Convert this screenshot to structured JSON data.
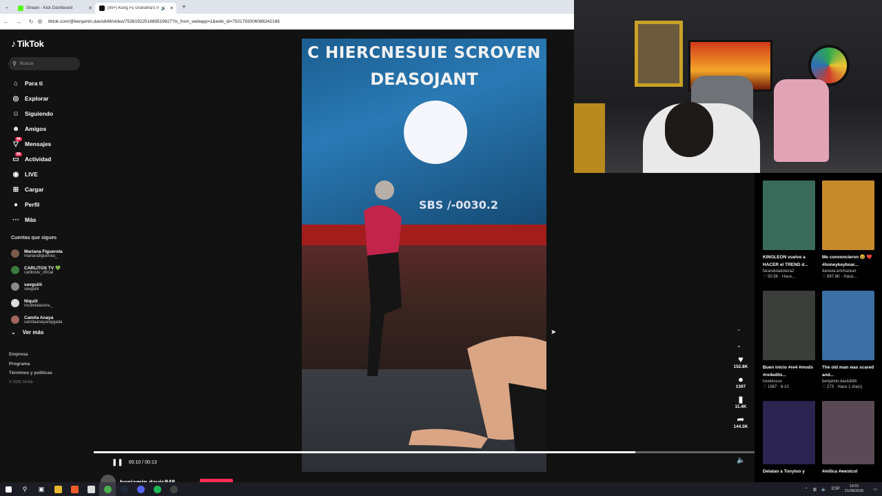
{
  "browser": {
    "tabs": [
      {
        "label": "Stream - Kick Dashboard",
        "color": "#53fc18"
      },
      {
        "label": "(99+) Kung Fu Grandma's Ir",
        "color": "#111111"
      }
    ],
    "url": "tiktok.com/@benjamin.davis848/video/7539192251889519927?is_from_webapp=1&web_id=7501793006086342166"
  },
  "tiktok": {
    "logo": "TikTok",
    "search_placeholder": "Buscar",
    "nav": [
      {
        "label": "Para ti",
        "icon": "home-icon"
      },
      {
        "label": "Explorar",
        "icon": "compass-icon"
      },
      {
        "label": "Siguiendo",
        "icon": "following-icon"
      },
      {
        "label": "Amigos",
        "icon": "friends-icon"
      },
      {
        "label": "Mensajes",
        "icon": "messages-icon",
        "badge": "44"
      },
      {
        "label": "Actividad",
        "icon": "activity-icon",
        "badge": "99"
      },
      {
        "label": "LIVE",
        "icon": "live-icon"
      },
      {
        "label": "Cargar",
        "icon": "upload-icon"
      },
      {
        "label": "Perfil",
        "icon": "profile-icon"
      },
      {
        "label": "Más",
        "icon": "more-icon"
      }
    ],
    "following_title": "Cuentas que sigues",
    "following": [
      {
        "name": "Mariana Figuerola",
        "handle": "marianafigueroia_"
      },
      {
        "name": "CARLITOS TV 💚",
        "handle": "carlitostv_oficial"
      },
      {
        "name": "savguiiii",
        "handle": "savguiiii"
      },
      {
        "name": "Niquiii",
        "handle": "nicoletalavera._"
      },
      {
        "name": "Camila Anaya",
        "handle": "camilaanayaraygada"
      }
    ],
    "see_more": "Ver más",
    "footer": [
      "Empresa",
      "Programa",
      "Términos y políticas"
    ],
    "copyright": "© 2025 TikTok"
  },
  "video": {
    "overlay_line1": "C HIERCNESUIE SCROVEN",
    "overlay_line2": "DEASOJANT",
    "overlay_code": "SBS /-0030.2",
    "time": "00:10 / 00:13",
    "progress": 0.82,
    "author": "benjamin.davis848",
    "stats": {
      "likes": "152.8K",
      "comments": "1397",
      "saves": "11.4K",
      "shares": "144.5K"
    }
  },
  "recommendations": [
    {
      "title": "KINGLEON vuelve a HACER el TREND d...",
      "author": "faranduladotera2",
      "stats": "♡ 50.5K · Hace...",
      "color": "#3a6b5a"
    },
    {
      "title": "Me convencieron 😆 ❤️#honeykeyboar...",
      "author": "daniela.emmanuel",
      "stats": "♡ 897.8K · Hace...",
      "color": "#c58a2a"
    },
    {
      "title": "Buen inicio #re4 #mods #re4edits...",
      "author": "lovelessuv",
      "stats": "♡ 1987 · 8-10",
      "color": "#3b3d3a"
    },
    {
      "title": "The old man was scared and...",
      "author": "benjamin.davis848",
      "stats": "♡ 273 · Hace 1 día(s)",
      "color": "#3b6ea3"
    },
    {
      "title": "Delatan a Tonyloo y",
      "author": "",
      "stats": "",
      "color": "#2b2350"
    },
    {
      "title": "#milica #westcol",
      "author": "",
      "stats": "",
      "color": "#5b4a55"
    }
  ],
  "taskbar": {
    "time": "19:01",
    "date": "21/08/2025",
    "lang": "ESP"
  }
}
